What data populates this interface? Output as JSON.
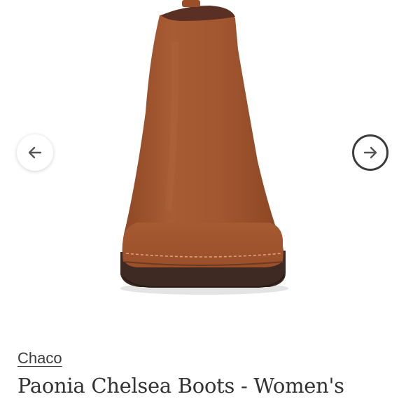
{
  "gallery": {
    "image_name": "boot-product-image",
    "prev_icon": "arrow-left-icon",
    "next_icon": "arrow-right-icon"
  },
  "product": {
    "brand": "Chaco",
    "title": "Paonia Chelsea Boots - Women's"
  },
  "colors": {
    "suede": "#a0552e",
    "sole": "#3e2a22",
    "nav_border": "#3b3b3b",
    "text": "#333333"
  }
}
